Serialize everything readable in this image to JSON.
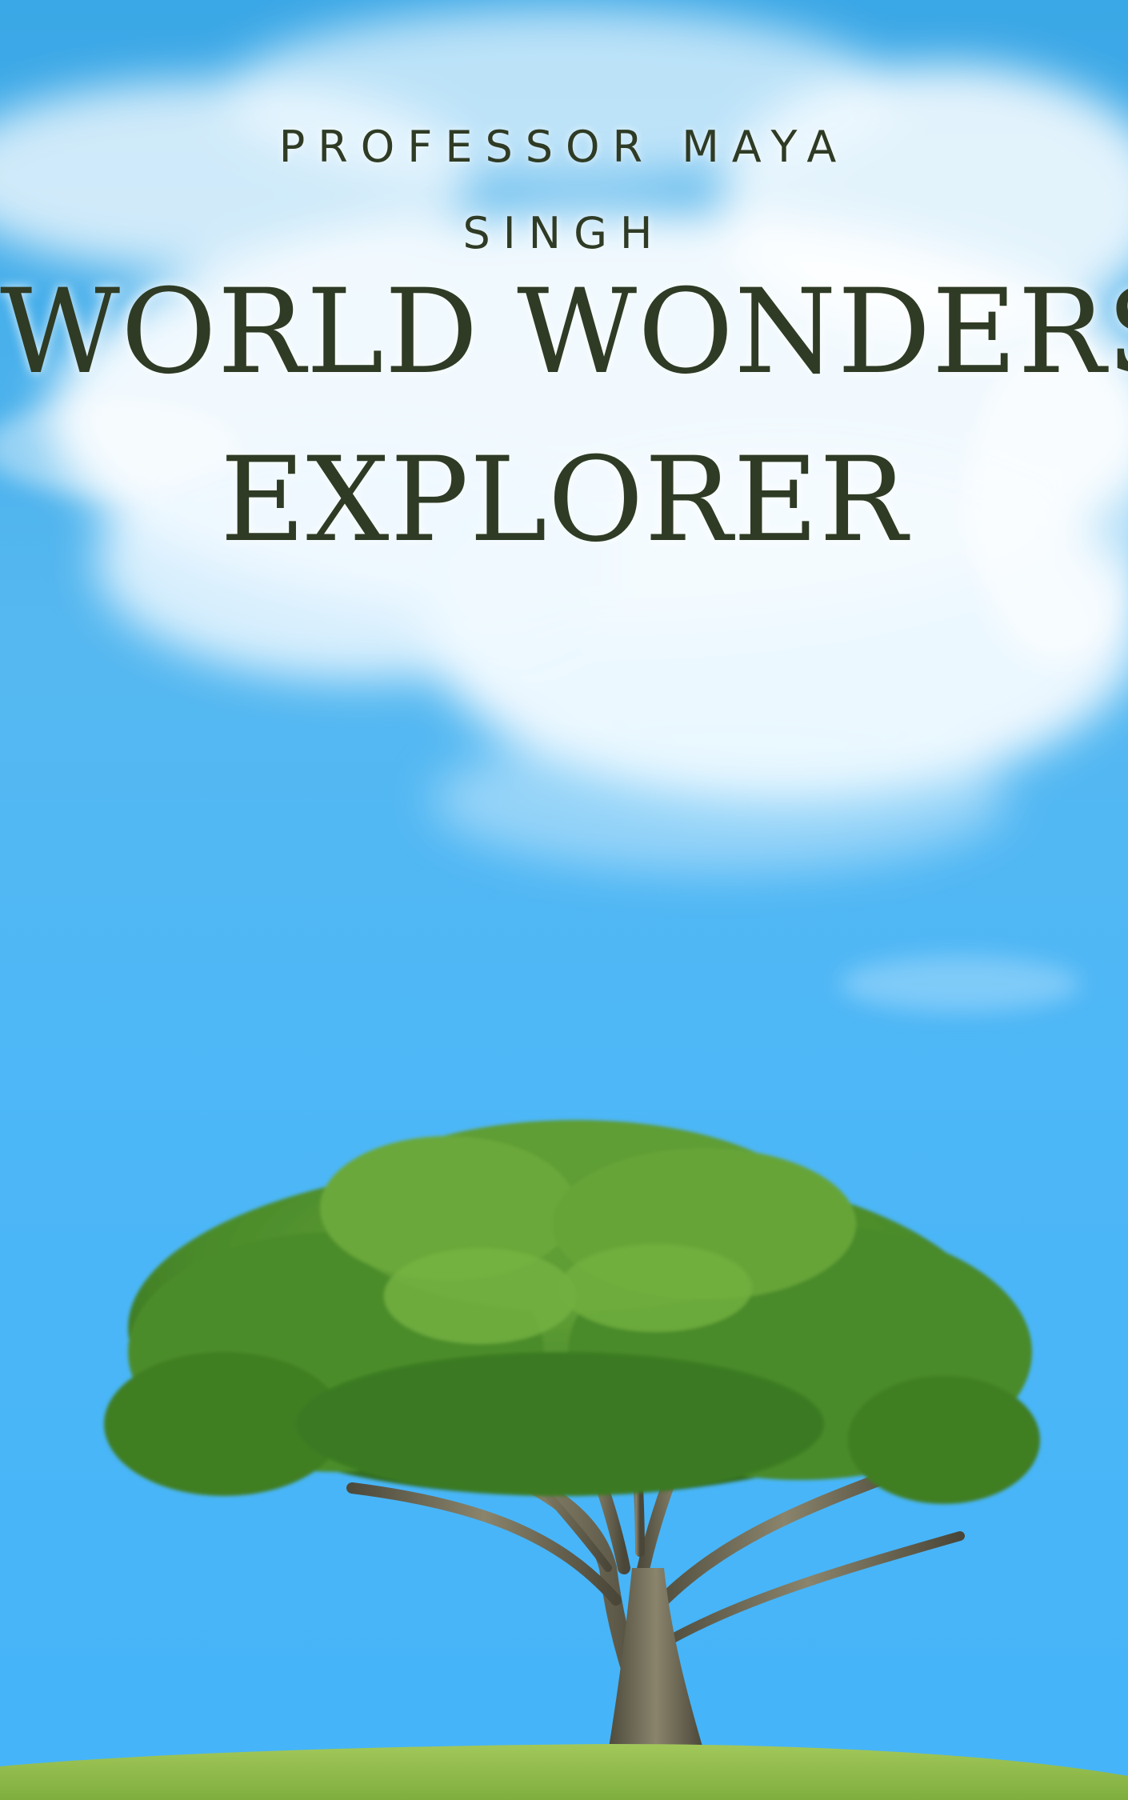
{
  "cover": {
    "author_line1": "PROFESSOR MAYA",
    "author_line2": "SINGH",
    "title_line1": "WORLD WONDERS",
    "title_line2": "EXPLORER"
  },
  "colors": {
    "sky_top": "#3aa7e6",
    "sky_bottom": "#45b4f8",
    "text": "#2f3b24",
    "foliage": "#4f8f2c",
    "trunk": "#6f6a55",
    "grass": "#8fbf4a"
  },
  "illustration": {
    "subject": "lone-tree-on-grass-under-cloudy-sky"
  }
}
